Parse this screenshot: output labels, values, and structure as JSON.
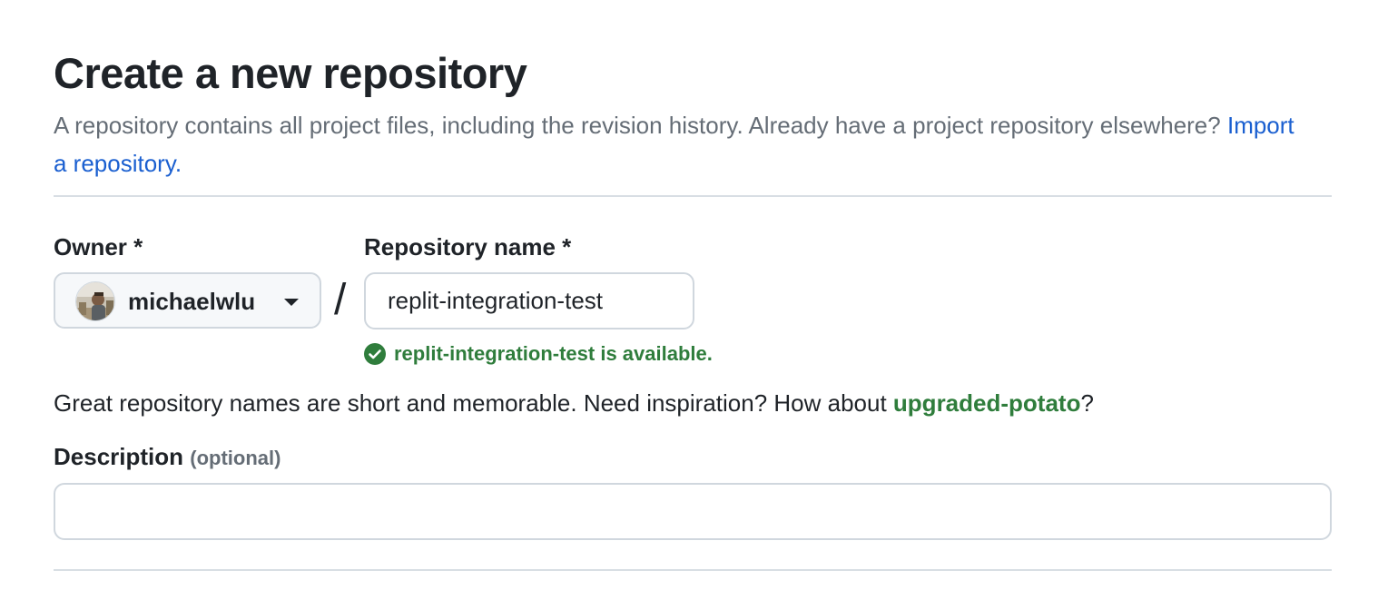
{
  "page": {
    "title": "Create a new repository",
    "subtitle_text": "A repository contains all project files, including the revision history. Already have a project repository elsewhere?",
    "import_link": "Import a repository."
  },
  "owner": {
    "label": "Owner *",
    "selected": "michaelwlu",
    "avatar_icon": "user-avatar-photo"
  },
  "separator": "/",
  "repository": {
    "label": "Repository name *",
    "value": "replit-integration-test",
    "availability_message": "replit-integration-test is available.",
    "availability_icon": "check-circle-icon"
  },
  "hint": {
    "prefix": "Great repository names are short and memorable. Need inspiration? How about ",
    "suggestion": "upgraded-potato",
    "suffix": "?"
  },
  "description": {
    "label": "Description",
    "optional_tag": "(optional)",
    "value": "",
    "placeholder": ""
  },
  "colors": {
    "link": "#1a5fd0",
    "success": "#2f7d3c",
    "muted_text": "#656d76",
    "border": "#d0d7de"
  }
}
